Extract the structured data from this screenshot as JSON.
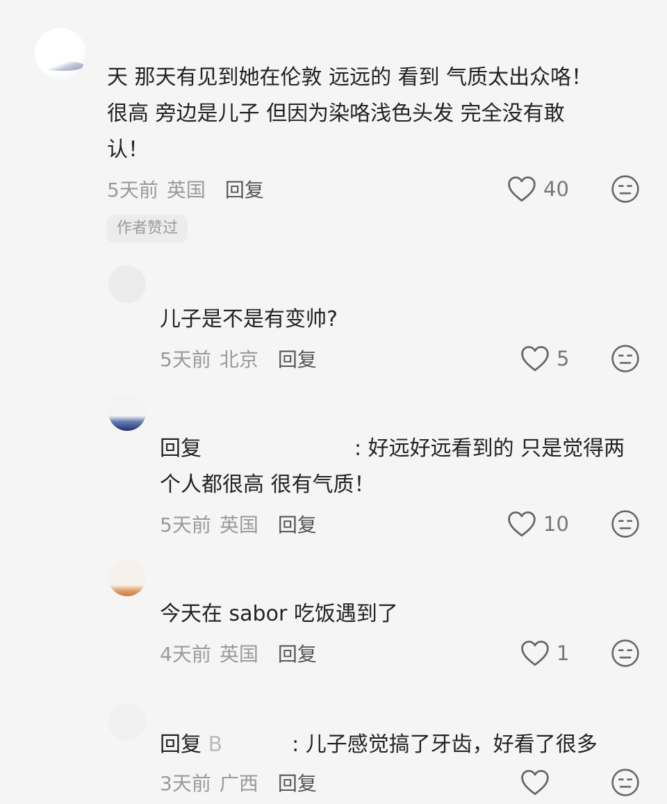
{
  "comments": [
    {
      "text": "天 那天有见到她在伦敦 远远的 看到 气质太出众咯！很高 旁边是儿子 但因为染咯浅色头发 完全没有敢认！",
      "line1": "天 那天有见到她在伦敦 远远的 看到 气质太出众咯！",
      "line2": "很高 旁边是儿子 但因为染咯浅色头发 完全没有敢",
      "line3": "认！",
      "time": "5天前",
      "location": "英国",
      "reply_label": "回复",
      "likes": "40",
      "badge": "作者赞过"
    },
    {
      "text": "儿子是不是有变帅?",
      "time": "5天前",
      "location": "北京",
      "reply_label": "回复",
      "likes": "5"
    },
    {
      "prefix": "回复",
      "line1": ": 好远好远看到的 只是觉得两",
      "line2": "个人都很高 很有气质！",
      "time": "5天前",
      "location": "英国",
      "reply_label": "回复",
      "likes": "10"
    },
    {
      "text": "今天在 sabor 吃饭遇到了",
      "time": "4天前",
      "location": "英国",
      "reply_label": "回复",
      "likes": "1"
    },
    {
      "prefix": "回复",
      "name_partial": "B",
      "text": ": 儿子感觉搞了牙齿，好看了很多",
      "time": "3天前",
      "location": "广西",
      "reply_label": "回复",
      "likes": ""
    }
  ],
  "icons": {
    "like": "heart-outline-icon",
    "dislike": "neutral-face-icon"
  }
}
